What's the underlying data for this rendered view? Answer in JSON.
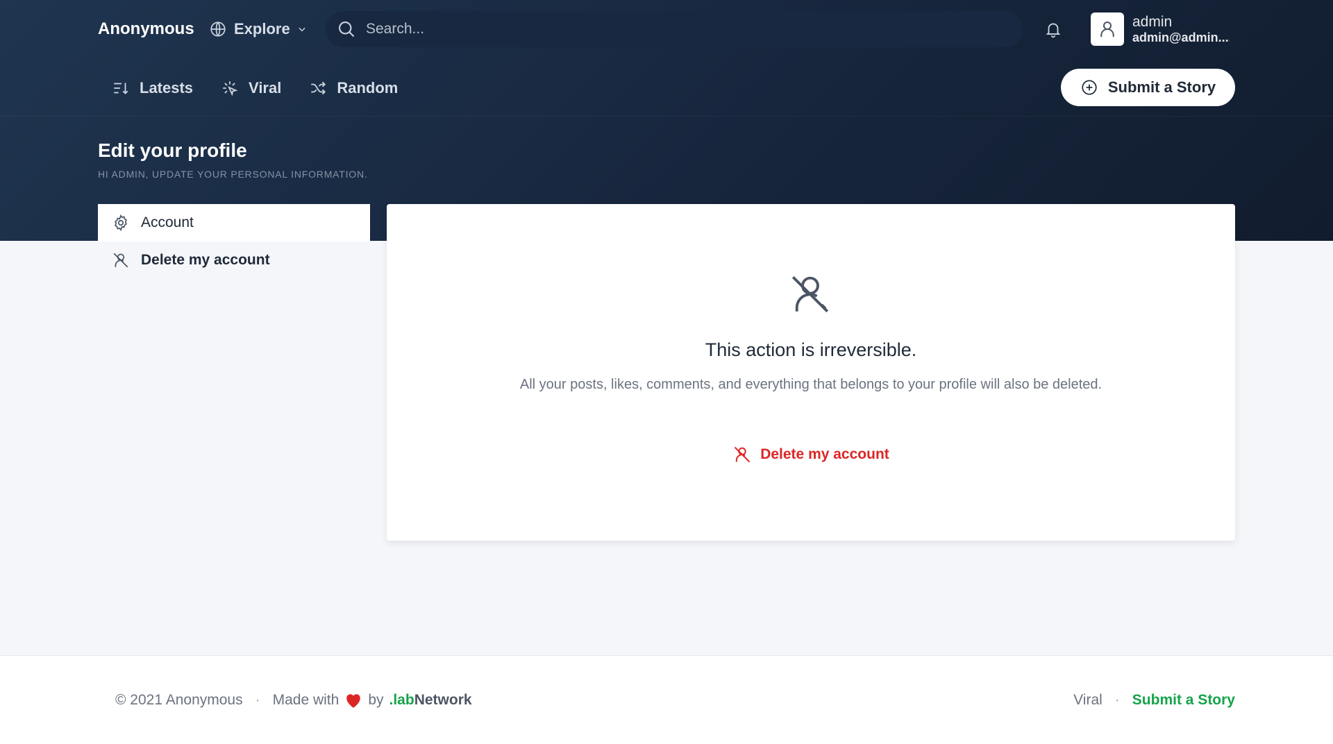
{
  "header": {
    "brand": "Anonymous",
    "explore_label": "Explore",
    "search_placeholder": "Search...",
    "user_name": "admin",
    "user_email": "admin@admin...."
  },
  "nav": {
    "items": [
      {
        "label": "Latests",
        "icon": "sort-icon"
      },
      {
        "label": "Viral",
        "icon": "sparkle-icon"
      },
      {
        "label": "Random",
        "icon": "shuffle-icon"
      }
    ],
    "submit_label": "Submit a Story"
  },
  "page": {
    "title": "Edit your profile",
    "subtitle": "HI ADMIN, UPDATE YOUR PERSONAL INFORMATION."
  },
  "sidebar": {
    "items": [
      {
        "label": "Account",
        "icon": "gear-icon",
        "active": true
      },
      {
        "label": "Delete my account",
        "icon": "user-off-icon",
        "active": false
      }
    ]
  },
  "card": {
    "title": "This action is irreversible.",
    "description": "All your posts, likes, comments, and everything that belongs to your profile will also be deleted.",
    "delete_label": "Delete my account"
  },
  "footer": {
    "copyright": "© 2021 Anonymous",
    "made_with": "Made with",
    "by": "by",
    "brand_prefix": ".lab",
    "brand_suffix": "Network",
    "viral": "Viral",
    "submit": "Submit a Story"
  },
  "colors": {
    "accent_green": "#16a34a",
    "danger_red": "#dc2626",
    "hero_bg": "#17263d"
  }
}
